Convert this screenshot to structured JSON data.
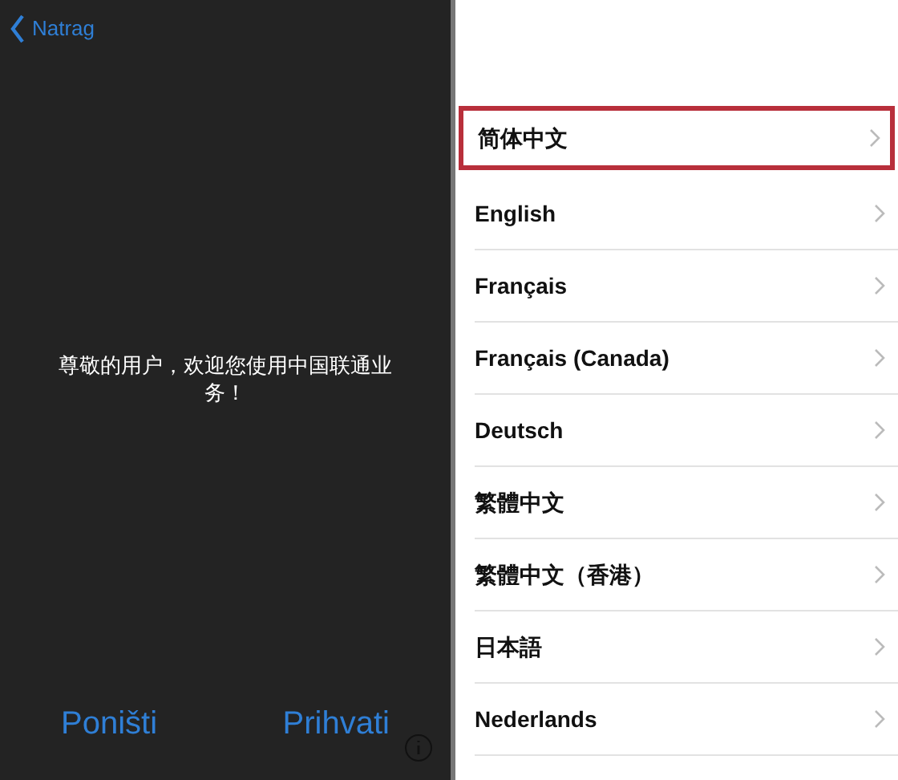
{
  "left_panel": {
    "back_link": "Natrag",
    "message": "尊敬的用户，欢迎您使用中国联通业务！",
    "buttons": [
      "Poništi",
      "Prihvati"
    ]
  },
  "languages": [
    {
      "label": "简体中文",
      "selected": true
    },
    {
      "label": "English",
      "selected": false
    },
    {
      "label": "Français",
      "selected": false
    },
    {
      "label": "Français (Canada)",
      "selected": false
    },
    {
      "label": "Deutsch",
      "selected": false
    },
    {
      "label": "繁體中文",
      "selected": false
    },
    {
      "label": "繁體中文（香港）",
      "selected": false
    },
    {
      "label": "日本語",
      "selected": false
    },
    {
      "label": "Nederlands",
      "selected": false
    }
  ]
}
